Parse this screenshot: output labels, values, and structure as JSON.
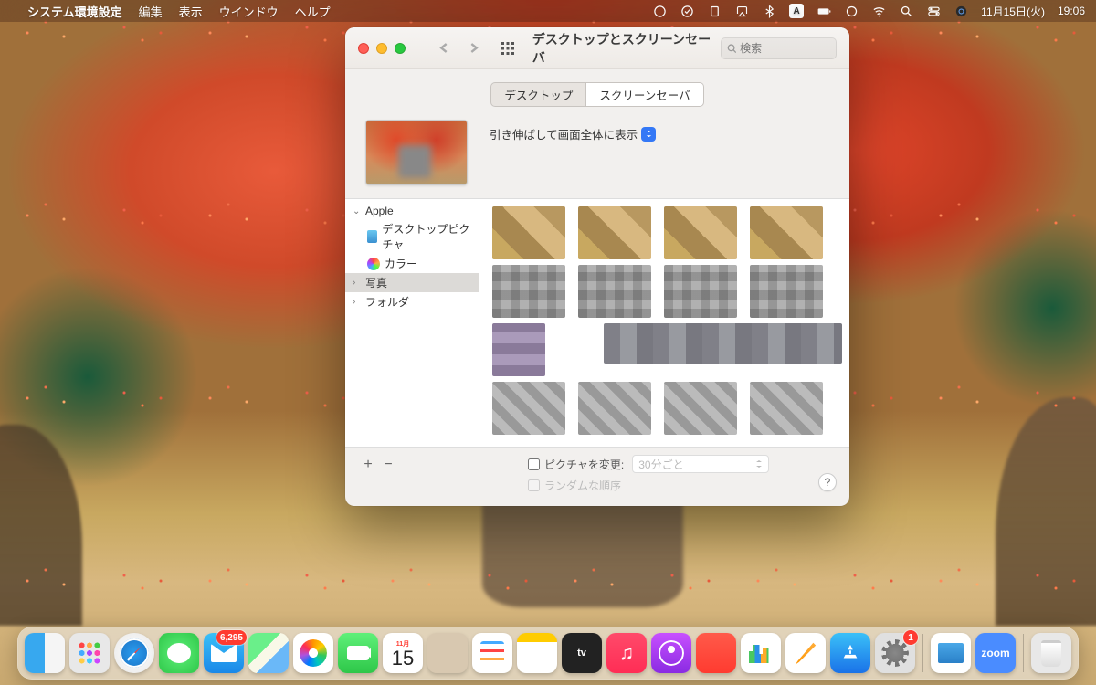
{
  "menubar": {
    "app": "システム環境設定",
    "items": [
      "編集",
      "表示",
      "ウインドウ",
      "ヘルプ"
    ],
    "ime": "A",
    "date": "11月15日(火)",
    "time": "19:06"
  },
  "window": {
    "title": "デスクトップとスクリーンセーバ",
    "search_placeholder": "検索",
    "tabs": {
      "desktop": "デスクトップ",
      "screensaver": "スクリーンセーバ"
    },
    "fit_mode": "引き伸ばして画面全体に表示",
    "sidebar": {
      "apple": "Apple",
      "desktop_pictures": "デスクトップピクチャ",
      "colors": "カラー",
      "photos": "写真",
      "folders": "フォルダ"
    },
    "footer": {
      "change_picture": "ピクチャを変更:",
      "interval": "30分ごと",
      "random": "ランダムな順序"
    },
    "help": "?"
  },
  "dock": {
    "mail_badge": "6,295",
    "cal_month": "11月",
    "cal_day": "15",
    "tv": "tv",
    "zoom": "zoom",
    "sysprefs_badge": "1"
  }
}
